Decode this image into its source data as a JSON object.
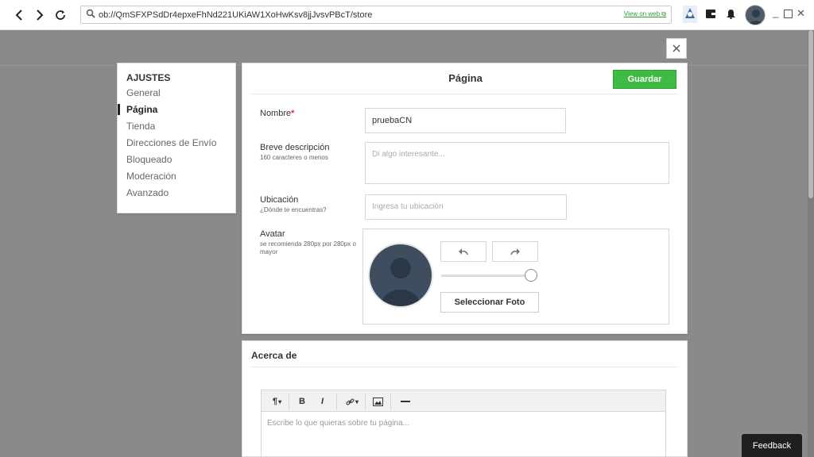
{
  "browser": {
    "url": "ob://QmSFXPSdDr4epxeFhNd221UKiAW1XoHwKsv8jjJvsvPBcT/store",
    "view_on_web": "View on web"
  },
  "menu": {
    "title": "AJUSTES",
    "items": [
      {
        "label": "General"
      },
      {
        "label": "Página"
      },
      {
        "label": "Tienda"
      },
      {
        "label": "Direcciones de Envío"
      },
      {
        "label": "Bloqueado"
      },
      {
        "label": "Moderación"
      },
      {
        "label": "Avanzado"
      }
    ],
    "active": "Página"
  },
  "panel": {
    "title": "Página",
    "save_label": "Guardar",
    "name_label": "Nombre",
    "required_mark": "*",
    "name_value": "pruebaCN",
    "desc_label": "Breve descripción",
    "desc_hint": "160 caracteres o menos",
    "desc_placeholder": "Di algo interesante...",
    "location_label": "Ubicación",
    "location_hint": "¿Dónde te encuentras?",
    "location_placeholder": "Ingresa tu ubicación",
    "avatar_label": "Avatar",
    "avatar_hint": "se recomienda 280px por 280px o mayor",
    "select_photo": "Seleccionar Foto"
  },
  "about": {
    "title": "Acerca de",
    "editor_placeholder": "Escribe lo que quieras sobre tu página..."
  },
  "feedback": "Feedback",
  "colors": {
    "accent_green": "#3fbb43",
    "link_green": "#2a9d3a",
    "required_red": "#d0302b"
  }
}
